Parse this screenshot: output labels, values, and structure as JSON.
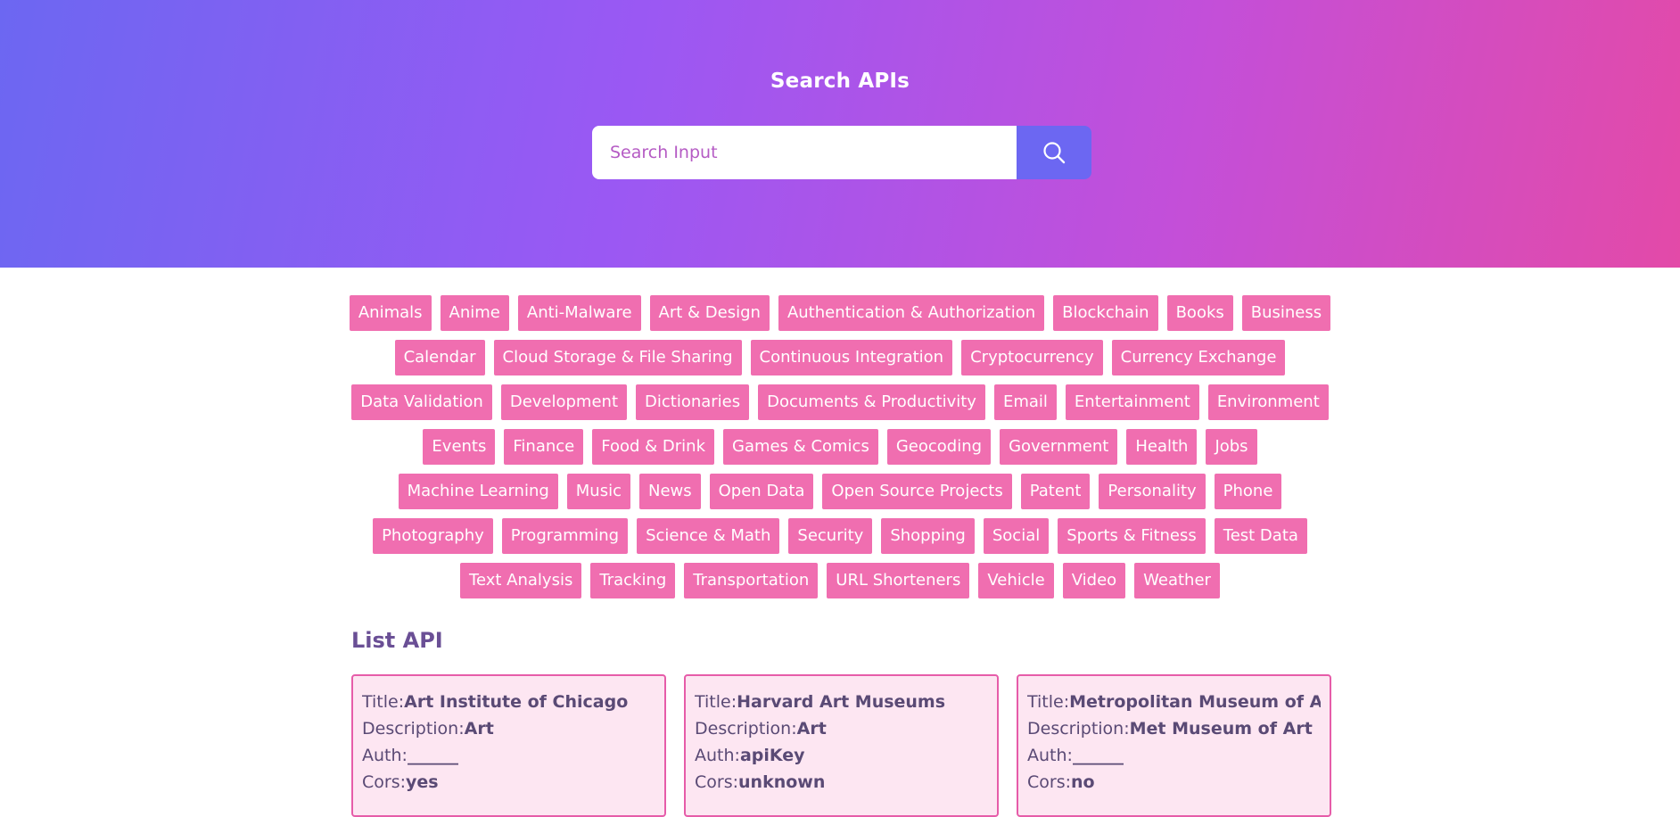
{
  "header": {
    "title": "Search APIs",
    "search_placeholder": "Search Input",
    "search_icon": "search-icon"
  },
  "colors": {
    "gradient_start": "#6c67f2",
    "gradient_mid": "#9b58f3",
    "gradient_end": "#e34aa8",
    "tag_bg": "#f06eb0",
    "card_bg": "#fde6f2",
    "card_border": "#e65ca9",
    "heading": "#6a4f95"
  },
  "categories": [
    "Animals",
    "Anime",
    "Anti-Malware",
    "Art & Design",
    "Authentication & Authorization",
    "Blockchain",
    "Books",
    "Business",
    "Calendar",
    "Cloud Storage & File Sharing",
    "Continuous Integration",
    "Cryptocurrency",
    "Currency Exchange",
    "Data Validation",
    "Development",
    "Dictionaries",
    "Documents & Productivity",
    "Email",
    "Entertainment",
    "Environment",
    "Events",
    "Finance",
    "Food & Drink",
    "Games & Comics",
    "Geocoding",
    "Government",
    "Health",
    "Jobs",
    "Machine Learning",
    "Music",
    "News",
    "Open Data",
    "Open Source Projects",
    "Patent",
    "Personality",
    "Phone",
    "Photography",
    "Programming",
    "Science & Math",
    "Security",
    "Shopping",
    "Social",
    "Sports & Fitness",
    "Test Data",
    "Text Analysis",
    "Tracking",
    "Transportation",
    "URL Shorteners",
    "Vehicle",
    "Video",
    "Weather"
  ],
  "list": {
    "heading": "List API",
    "field_labels": {
      "title": "Title:",
      "description": "Description:",
      "auth": "Auth:",
      "cors": "Cors:"
    },
    "items": [
      {
        "title": "Art Institute of Chicago",
        "description": "Art",
        "auth": "______",
        "cors": "yes"
      },
      {
        "title": "Harvard Art Museums",
        "description": "Art",
        "auth": "apiKey",
        "cors": "unknown"
      },
      {
        "title": "Metropolitan Museum of Art",
        "description": "Met Museum of Art",
        "auth": "______",
        "cors": "no"
      }
    ]
  }
}
